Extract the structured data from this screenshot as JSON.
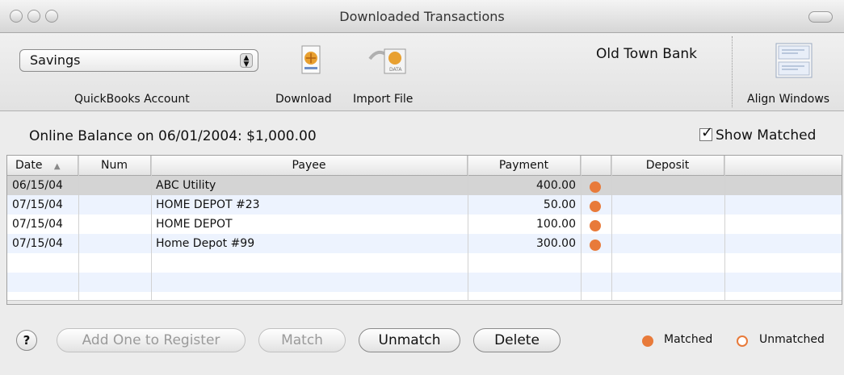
{
  "window": {
    "title": "Downloaded Transactions"
  },
  "toolbar": {
    "account_select_value": "Savings",
    "account_label": "QuickBooks Account",
    "download_label": "Download",
    "import_label": "Import File",
    "bank_name": "Old Town Bank",
    "align_label": "Align Windows"
  },
  "balance": {
    "text": "Online Balance on 06/01/2004: $1,000.00"
  },
  "show_matched": {
    "label": "Show Matched",
    "checked": true
  },
  "table": {
    "columns": [
      "Date",
      "Num",
      "Payee",
      "Payment",
      "",
      "Deposit",
      ""
    ],
    "sort_indicator": "▲",
    "rows": [
      {
        "date": "06/15/04",
        "num": "",
        "payee": "ABC Utility",
        "payment": "400.00",
        "status": "matched",
        "deposit": ""
      },
      {
        "date": "07/15/04",
        "num": "",
        "payee": "HOME DEPOT #23",
        "payment": "50.00",
        "status": "matched",
        "deposit": ""
      },
      {
        "date": "07/15/04",
        "num": "",
        "payee": "HOME DEPOT",
        "payment": "100.00",
        "status": "matched",
        "deposit": ""
      },
      {
        "date": "07/15/04",
        "num": "",
        "payee": "Home Depot #99",
        "payment": "300.00",
        "status": "matched",
        "deposit": ""
      }
    ]
  },
  "buttons": {
    "help": "?",
    "add_one": "Add One to Register",
    "match": "Match",
    "unmatch": "Unmatch",
    "delete": "Delete"
  },
  "legend": {
    "matched": "Matched",
    "unmatched": "Unmatched"
  },
  "colors": {
    "matched_dot": "#e87a3a",
    "selected_row": "#d4d4d4",
    "alt_row": "#edf3fe"
  }
}
